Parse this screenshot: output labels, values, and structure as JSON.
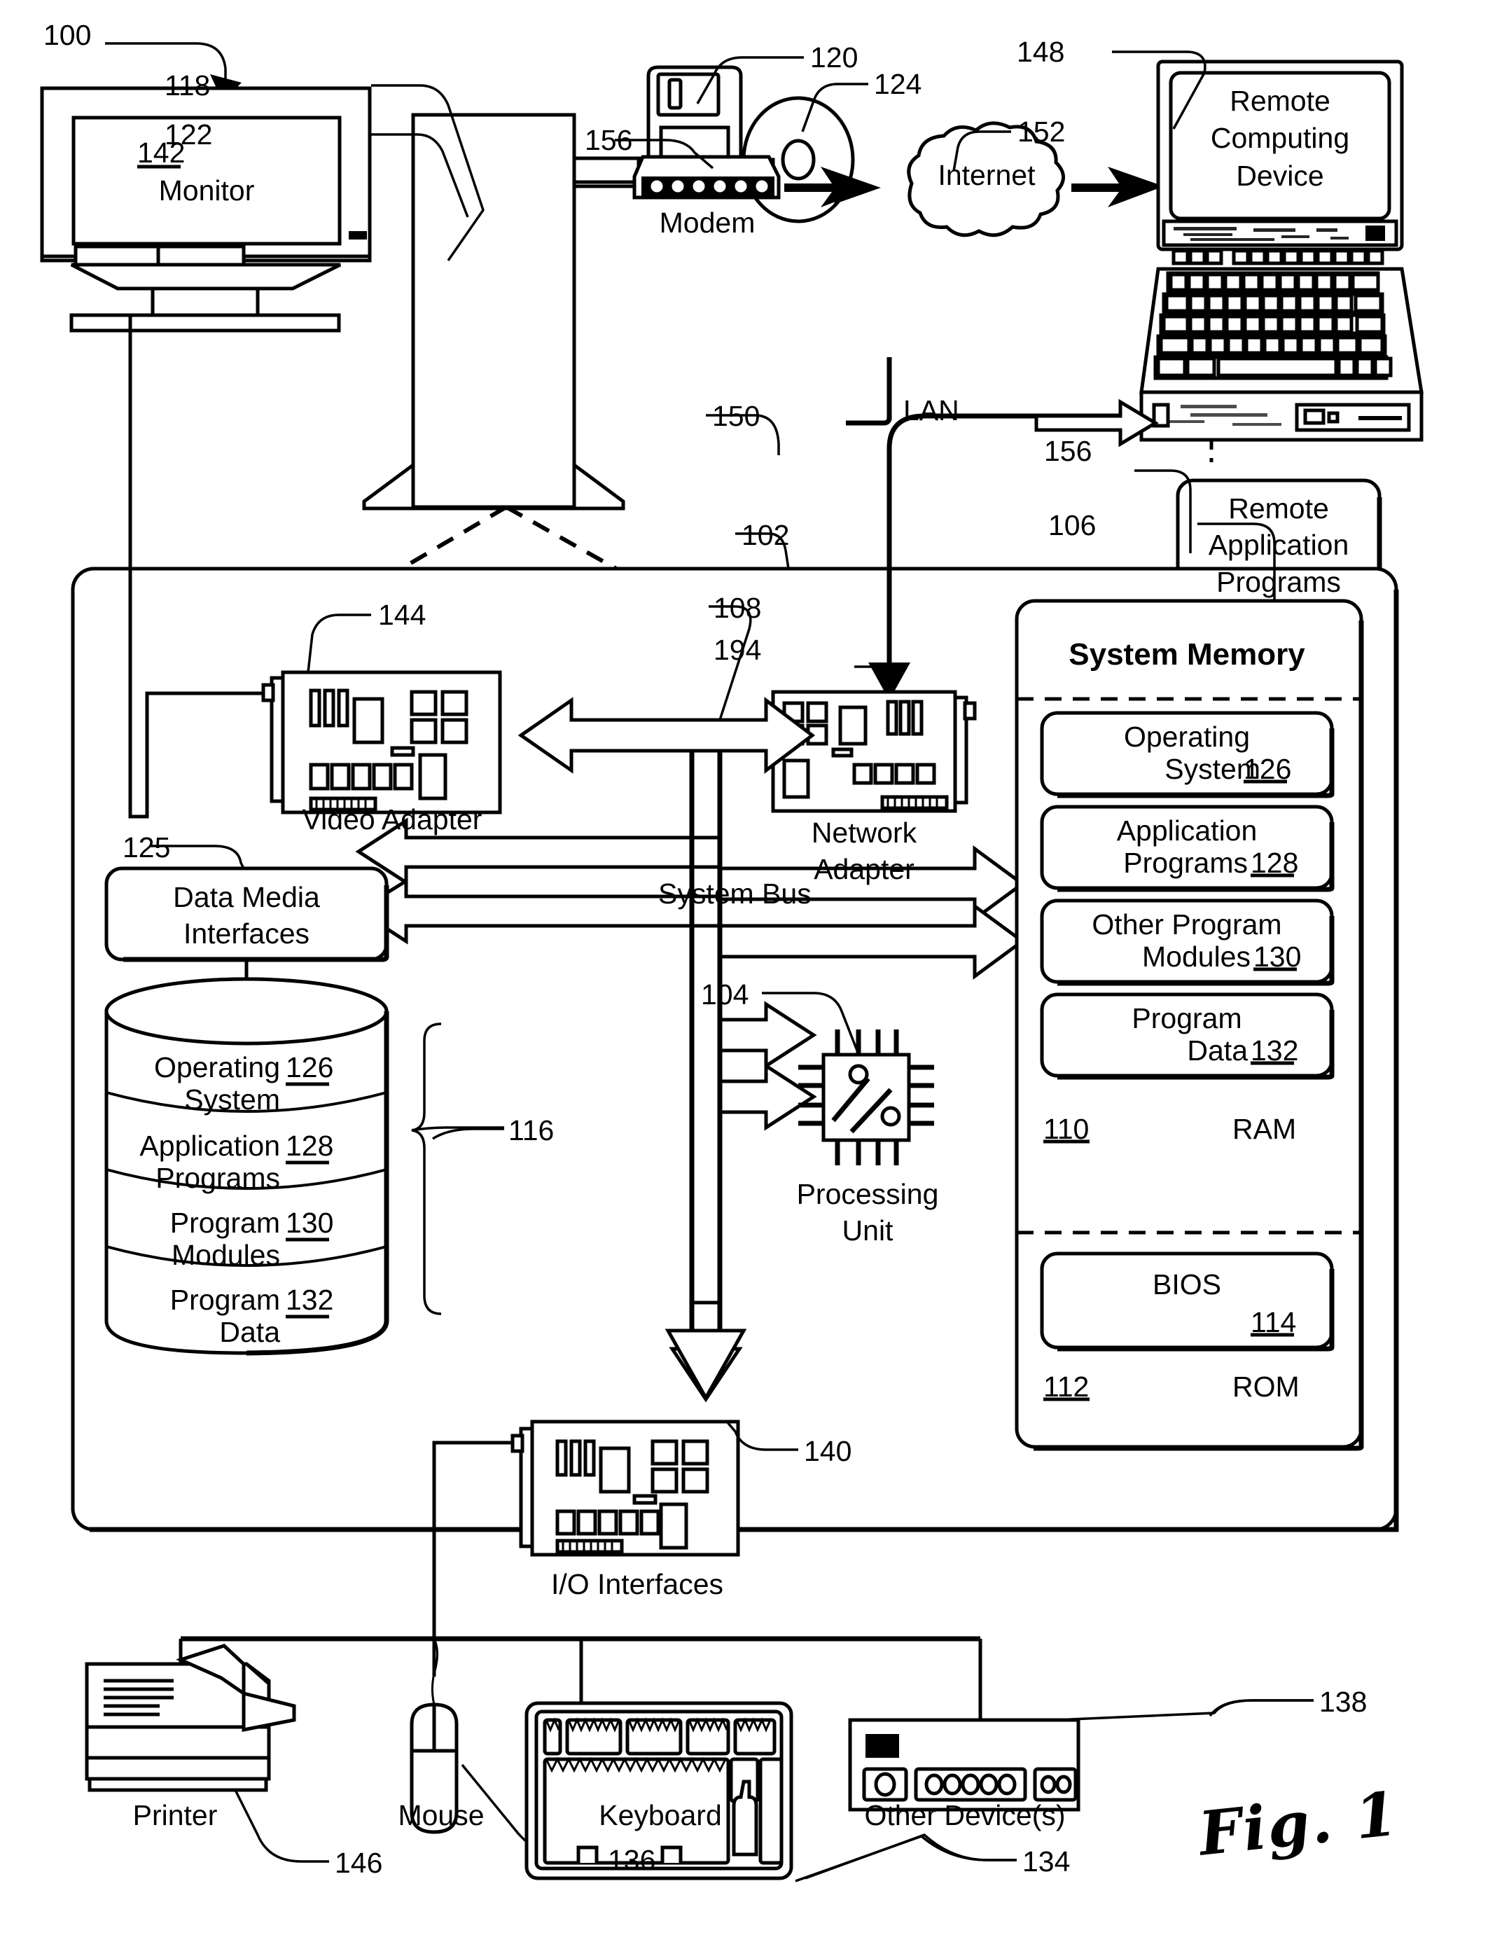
{
  "figure": {
    "caption": "Fig. 1",
    "root_ref": "100"
  },
  "refs": {
    "system": "100",
    "computer_env": "102",
    "processing_unit": "104",
    "system_memory": "106",
    "system_bus": "108",
    "ram": "110",
    "rom": "112",
    "bios": "114",
    "storage_brace": "116",
    "tower": "118",
    "floppy_drive": "120",
    "computer": "122",
    "optical_disc": "124",
    "data_media_interfaces": "125",
    "operating_system": "126",
    "application_programs": "128",
    "other_program_modules": "130",
    "program_data": "132",
    "keyboard": "134",
    "mouse": "136",
    "other_devices": "138",
    "io_interfaces": "140",
    "monitor": "142",
    "video_adapter": "144",
    "printer": "146",
    "remote_computing_device": "148",
    "lan_link": "150",
    "internet": "152",
    "modem": "156",
    "remote_application_programs": "156",
    "network_adapter": "194"
  },
  "devices": {
    "monitor_label": "Monitor",
    "modem_label": "Modem",
    "internet_label": "Internet",
    "remote_computing_device_label": "Remote\nComputing\nDevice",
    "remote_application_programs_label": "Remote\nApplication\nPrograms",
    "lan_label": "LAN",
    "printer_label": "Printer",
    "mouse_label": "Mouse",
    "keyboard_label": "Keyboard",
    "other_devices_label": "Other Device(s)",
    "io_interfaces_label": "I/O Interfaces",
    "video_adapter_label": "Video Adapter",
    "network_adapter_label": "Network\nAdapter",
    "processing_unit_label": "Processing\nUnit",
    "system_bus_label": "System Bus",
    "data_media_interfaces_label": "Data Media\nInterfaces"
  },
  "system_memory": {
    "title": "System Memory",
    "ram_label": "RAM",
    "rom_label": "ROM",
    "blocks": [
      {
        "line1": "Operating",
        "line2": "System",
        "ref": "126"
      },
      {
        "line1": "Application",
        "line2": "Programs",
        "ref": "128"
      },
      {
        "line1": "Other Program",
        "line2": "Modules",
        "ref": "130"
      },
      {
        "line1": "Program",
        "line2": "Data",
        "ref": "132"
      },
      {
        "line1": "BIOS",
        "line2": "",
        "ref": "114"
      }
    ]
  },
  "disk_stack": {
    "rows": [
      {
        "line1": "Operating",
        "line2": "System",
        "ref": "126"
      },
      {
        "line1": "Application",
        "line2": "Programs",
        "ref": "128"
      },
      {
        "line1": "Program",
        "line2": "Modules",
        "ref": "130"
      },
      {
        "line1": "Program",
        "line2": "Data",
        "ref": "132"
      }
    ]
  },
  "colors": {
    "ink": "#000000",
    "paper": "#ffffff"
  }
}
